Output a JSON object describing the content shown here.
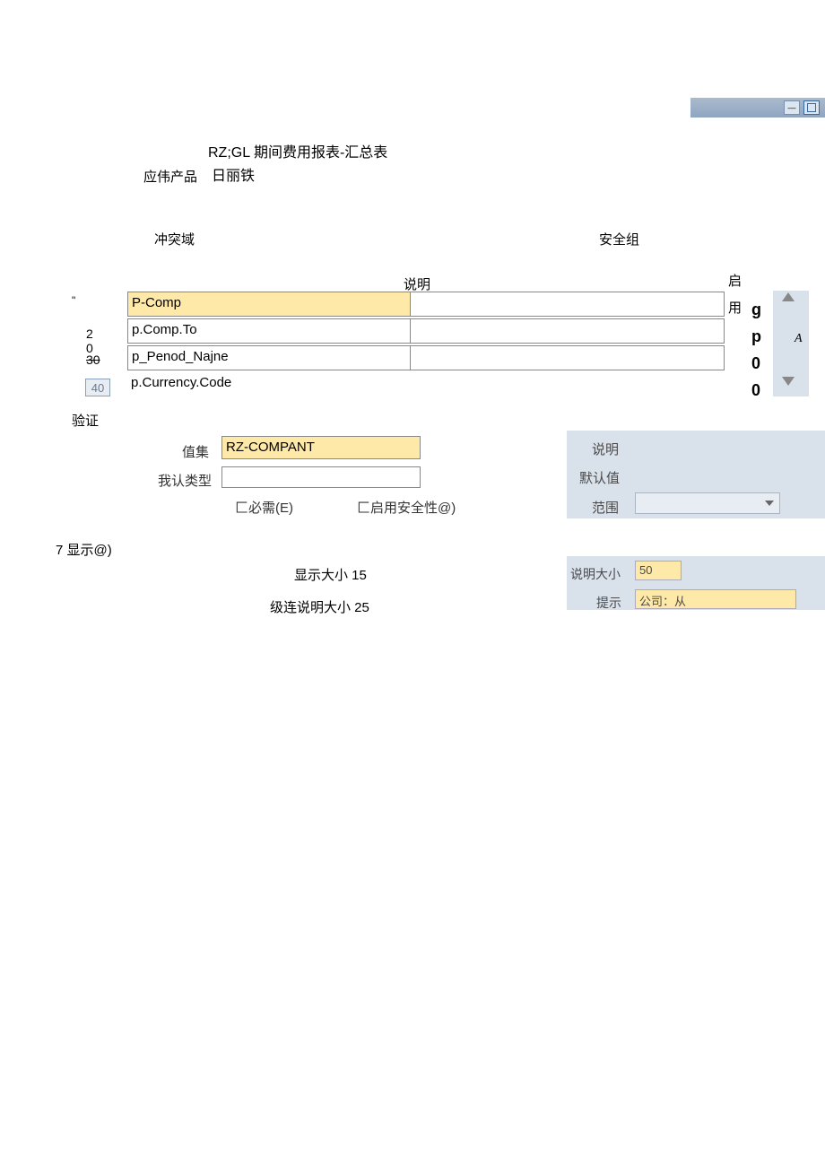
{
  "titlebar": {},
  "page_title": "RZ;GL 期间费用报表-汇总表",
  "product_label": "应伟产品",
  "product_value": "日丽铁",
  "conflict_label": "冲突域",
  "security_label": "安全组",
  "table_headers": {
    "desc": "说明",
    "enable_l1": "启",
    "enable_l2": "用"
  },
  "quote_mark": "\"",
  "left_nums": {
    "a": "2",
    "b": "0",
    "c": "30",
    "d": "40"
  },
  "verify_label": "验证",
  "params": [
    {
      "name": "P-Comp"
    },
    {
      "name": "p.Comp.To"
    },
    {
      "name": "p_Penod_Najne"
    },
    {
      "name": "p.Currency.Code"
    }
  ],
  "col_gp0": [
    "g",
    "p",
    "0",
    "0"
  ],
  "col_A": "A",
  "valueset_label": "值集",
  "valueset_value": "RZ-COMPANT",
  "recog_label": "我认类型",
  "checks": {
    "required": "匚必需(E)",
    "security": "匚启用安全性@)"
  },
  "right": {
    "desc": "说明",
    "default": "默认值",
    "range": "范围"
  },
  "display_section": "7 显示@)",
  "display_size_label": "显示大小 15",
  "cascade_label": "级连说明大小 25",
  "desc_size_label": "说明大小",
  "desc_size_value": "50",
  "tip_label": "提示",
  "tip_value": "公司：从"
}
